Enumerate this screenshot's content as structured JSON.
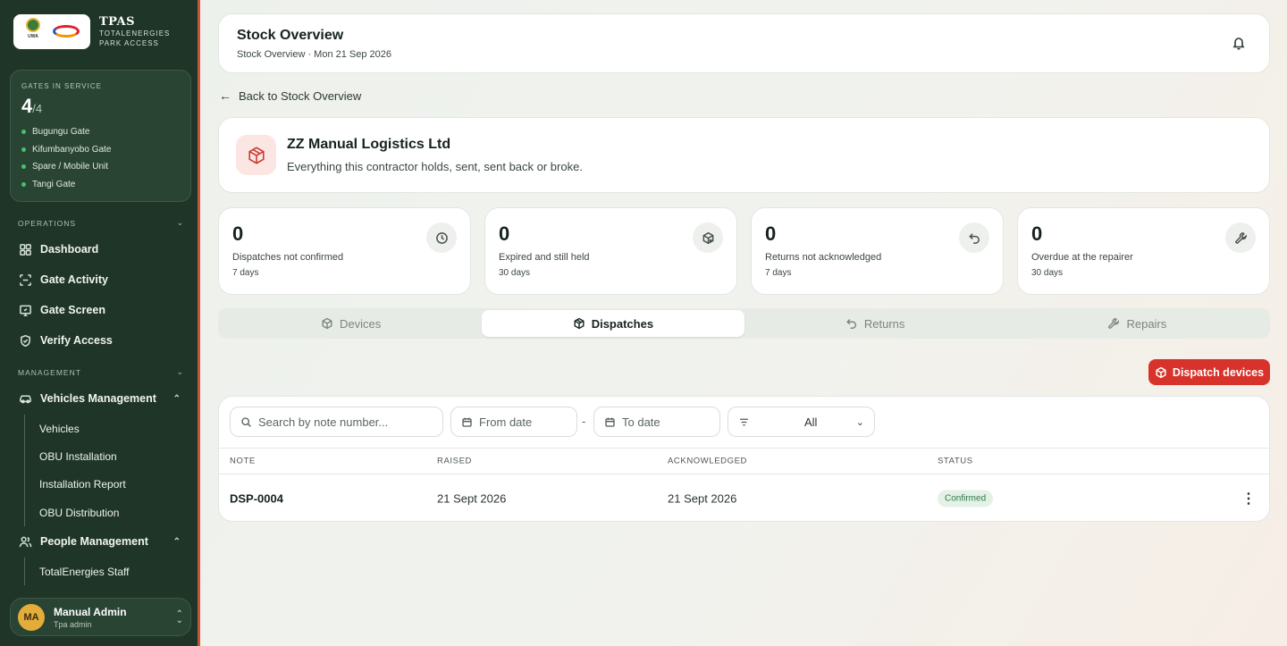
{
  "brand": {
    "title": "TPAS",
    "subtitle_line1": "TOTALENERGIES",
    "subtitle_line2": "PARK ACCESS",
    "uwa_text": "UWA"
  },
  "gates": {
    "label": "GATES IN SERVICE",
    "active": "4",
    "total": "/4",
    "items": [
      "Bugungu Gate",
      "Kifumbanyobo Gate",
      "Spare / Mobile Unit",
      "Tangi Gate"
    ]
  },
  "nav": {
    "operations_label": "OPERATIONS",
    "management_label": "MANAGEMENT",
    "operations": [
      "Dashboard",
      "Gate Activity",
      "Gate Screen",
      "Verify Access"
    ],
    "vehicles_management": "Vehicles Management",
    "vehicles_sub": [
      "Vehicles",
      "OBU Installation",
      "Installation Report",
      "OBU Distribution"
    ],
    "people_management": "People Management",
    "people_sub": [
      "TotalEnergies Staff"
    ]
  },
  "user": {
    "initials": "MA",
    "name": "Manual Admin",
    "role": "Tpa admin"
  },
  "header": {
    "title": "Stock Overview",
    "subtitle": "Stock Overview · Mon 21 Sep 2026"
  },
  "back_link": "Back to Stock Overview",
  "contractor": {
    "name": "ZZ Manual Logistics Ltd",
    "description": "Everything this contractor holds, sent, sent back or broke."
  },
  "stats": [
    {
      "value": "0",
      "label": "Dispatches not confirmed",
      "period": "7 days",
      "icon": "clock-icon"
    },
    {
      "value": "0",
      "label": "Expired and still held",
      "period": "30 days",
      "icon": "package-x-icon"
    },
    {
      "value": "0",
      "label": "Returns not acknowledged",
      "period": "7 days",
      "icon": "undo-icon"
    },
    {
      "value": "0",
      "label": "Overdue at the repairer",
      "period": "30 days",
      "icon": "wrench-icon"
    }
  ],
  "tabs": [
    "Devices",
    "Dispatches",
    "Returns",
    "Repairs"
  ],
  "active_tab": "Dispatches",
  "actions": {
    "dispatch_label": "Dispatch devices"
  },
  "filters": {
    "search_placeholder": "Search by note number...",
    "from_placeholder": "From date",
    "to_placeholder": "To date",
    "separator": "-",
    "status_value": "All"
  },
  "table": {
    "columns": [
      "NOTE",
      "RAISED",
      "ACKNOWLEDGED",
      "STATUS"
    ],
    "rows": [
      {
        "note": "DSP-0004",
        "raised": "21 Sept 2026",
        "acknowledged": "21 Sept 2026",
        "status": "Confirmed"
      }
    ]
  },
  "colors": {
    "sidebar": "#1f3527",
    "accent_red": "#d8332a",
    "status_green": "#2e7a48",
    "gate_dot": "#43c26a"
  }
}
